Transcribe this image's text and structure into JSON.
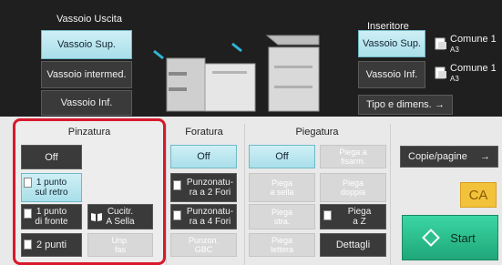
{
  "output_tray": {
    "title": "Vassoio Uscita",
    "buttons": [
      "Vassoio Sup.",
      "Vassoio intermed.",
      "Vassoio Inf."
    ]
  },
  "inserter": {
    "title": "Inseritore",
    "upper_label": "Vassoio Sup.",
    "upper_paper": "Comune 1",
    "upper_size": "A3",
    "lower_label": "Vassoio Inf.",
    "lower_paper": "Comune 1",
    "lower_size": "A3",
    "type_size_label": "Tipo e dimens.",
    "type_size_arrow": "→"
  },
  "stapling": {
    "title": "Pinzatura",
    "off": "Off",
    "back_1_line1": "1 punto",
    "back_1_line2": "sul retro",
    "front_1_line1": "1 punto",
    "front_1_line2": "di fronte",
    "two": "2 punti",
    "saddle_line1": "Cucitr.",
    "saddle_line2": "A Sella",
    "disabled_line1": "Unp.",
    "disabled_line2": "fas"
  },
  "punching": {
    "title": "Foratura",
    "off": "Off",
    "p2_line1": "Punzonatu-",
    "p2_line2": "ra a 2 Fori",
    "p4_line1": "Punzonatu-",
    "p4_line2": "ra a 4 Fori",
    "disabled_line1": "Punzon.",
    "disabled_line2": "GBC"
  },
  "folding": {
    "title": "Piegatura",
    "off": "Off",
    "disabled": [
      [
        "Piega a",
        "fisarm."
      ],
      [
        "Piega",
        "a sella"
      ],
      [
        "Piega",
        "doppia"
      ],
      [
        "Piega",
        "stra."
      ],
      [
        "Piega",
        "lettera"
      ]
    ],
    "z_line1": "Piega",
    "z_line2": "a Z",
    "details": "Dettagli"
  },
  "right": {
    "copies_label": "Copie/pagine",
    "copies_arrow": "→",
    "ca": "CA",
    "start": "Start"
  },
  "colors": {
    "accent_red": "#d9192b",
    "cyan": "#a9dfe9",
    "start_green": "#2fbf8f",
    "ca_yellow": "#f2c23a"
  }
}
